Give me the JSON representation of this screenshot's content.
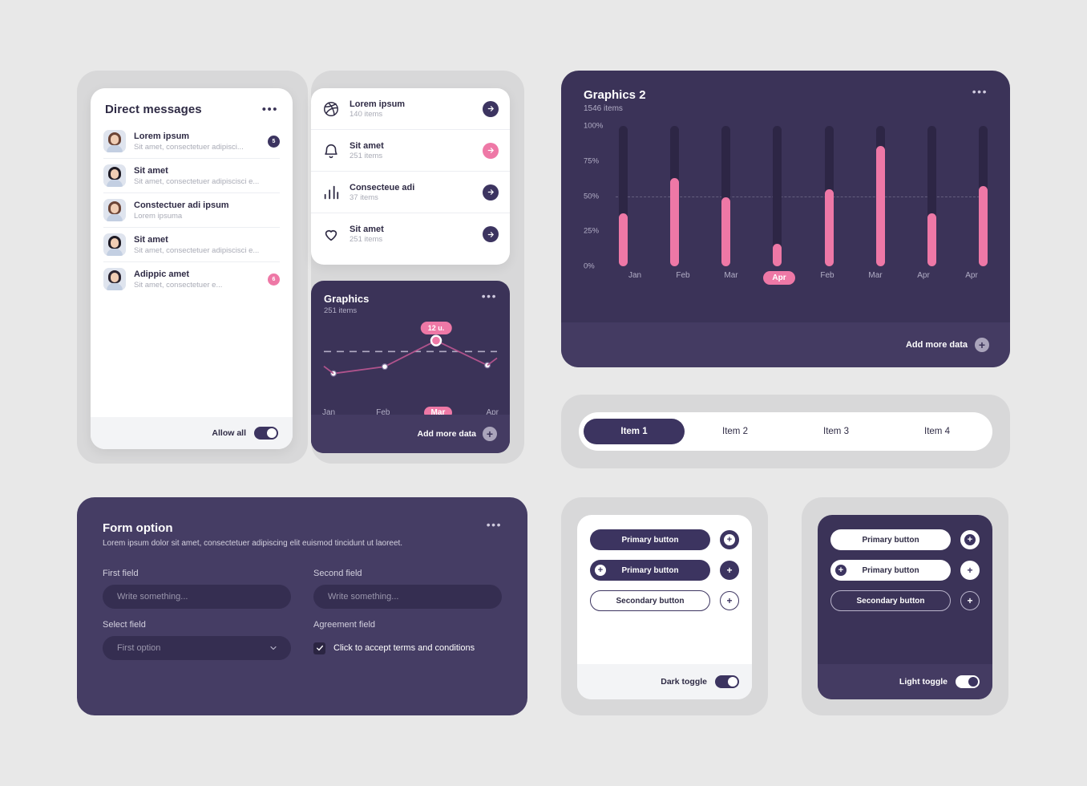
{
  "messages_card": {
    "title": "Direct messages",
    "menu_icon": "•••",
    "items": [
      {
        "name": "Lorem ipsum",
        "preview": "Sit amet, consectetuer adipisci...",
        "badge": "5",
        "badge_color": "#3c3460"
      },
      {
        "name": "Sit amet",
        "preview": "Sit amet, consectetuer adipiscisci e...",
        "badge": "",
        "badge_color": ""
      },
      {
        "name": "Constectuer adi ipsum",
        "preview": "Lorem ipsuma",
        "badge": "",
        "badge_color": ""
      },
      {
        "name": "Sit amet",
        "preview": "Sit amet, consectetuer adipiscisci e...",
        "badge": "",
        "badge_color": ""
      },
      {
        "name": "Adippic amet",
        "preview": "Sit amet, consectetuer e...",
        "badge": "6",
        "badge_color": "#ee78a6"
      }
    ],
    "footer": {
      "label": "Allow all",
      "toggle_state": "on"
    }
  },
  "icon_list_card": {
    "items": [
      {
        "icon": "dribbble-icon",
        "title": "Lorem ipsum",
        "subtitle": "140 items",
        "arrow_color": "#3c3460"
      },
      {
        "icon": "bell-icon",
        "title": "Sit amet",
        "subtitle": "251 items",
        "arrow_color": "#ee78a6"
      },
      {
        "icon": "bar-chart-icon",
        "title": "Consecteue adi",
        "subtitle": "37 items",
        "arrow_color": "#3c3460"
      },
      {
        "icon": "heart-icon",
        "title": "Sit amet",
        "subtitle": "251 items",
        "arrow_color": "#3c3460"
      }
    ]
  },
  "line_card": {
    "title": "Graphics",
    "subtitle": "251 items",
    "menu_icon": "•••",
    "footer_label": "Add more data",
    "plus_icon": "+"
  },
  "bar_card": {
    "title": "Graphics  2",
    "subtitle": "1546 items",
    "menu_icon": "•••",
    "footer_label": "Add more data",
    "plus_icon": "+"
  },
  "chart_data": [
    {
      "type": "line",
      "title": "Graphics",
      "subtitle": "251 items",
      "categories": [
        "Jan",
        "Feb",
        "Mar",
        "Apr"
      ],
      "values": [
        8,
        10.5,
        20,
        11
      ],
      "ylim": [
        0,
        24
      ],
      "active_category": "Mar",
      "tooltip": {
        "label": "12 u.",
        "category": "Mar"
      },
      "line_color": "#b0538c",
      "point_color": "#ffffff",
      "active_point_color": "#ee78a6",
      "reference_line": {
        "value": 16,
        "style": "dashed"
      },
      "grid": false,
      "legend": "none",
      "xlabel": "",
      "ylabel": ""
    },
    {
      "type": "bar",
      "title": "Graphics  2",
      "subtitle": "1546 items",
      "categories": [
        "Jan",
        "Feb",
        "Mar",
        "Apr",
        "Feb",
        "Mar",
        "Apr",
        "Apr"
      ],
      "values": [
        38,
        63,
        49,
        16,
        55,
        86,
        38,
        57
      ],
      "track_values": [
        100,
        100,
        100,
        100,
        100,
        100,
        100,
        100
      ],
      "ylim": [
        0,
        100
      ],
      "ytick_labels": [
        "100%",
        "75%",
        "50%",
        "25%",
        "0%"
      ],
      "yticks": [
        100,
        75,
        50,
        25,
        0
      ],
      "active_category_index": 3,
      "bar_color": "#ee78a6",
      "track_color": "#2d2645",
      "grid": true,
      "legend": "none",
      "xlabel": "",
      "ylabel": ""
    }
  ],
  "tabs": {
    "items": [
      {
        "label": "Item 1",
        "active": true
      },
      {
        "label": "Item 2",
        "active": false
      },
      {
        "label": "Item 3",
        "active": false
      },
      {
        "label": "Item 4",
        "active": false
      }
    ]
  },
  "form_card": {
    "title": "Form option",
    "description": "Lorem ipsum dolor sit amet, consectetuer adipiscing elit euismod tincidunt ut laoreet.",
    "menu_icon": "•••",
    "first_field": {
      "label": "First field",
      "value": "",
      "placeholder": "Write something..."
    },
    "second_field": {
      "label": "Second field",
      "value": "",
      "placeholder": "Write something..."
    },
    "select_field": {
      "label": "Select field",
      "selected": "First option",
      "chevron": "chevron-down-icon"
    },
    "agreement_field": {
      "label": "Agreement field",
      "checkbox_label": "Click to accept terms and conditions",
      "checked": true
    }
  },
  "buttons_light": {
    "primary_label": "Primary button",
    "primary_icon_label": "Primary button",
    "secondary_label": "Secondary button",
    "plus_icon": "+",
    "footer_label": "Dark toggle",
    "toggle_state": "on"
  },
  "buttons_dark": {
    "primary_label": "Primary button",
    "primary_icon_label": "Primary button",
    "secondary_label": "Secondary button",
    "plus_icon": "+",
    "footer_label": "Light toggle",
    "toggle_state": "on"
  },
  "theme": {
    "page_bg": "#e8e8e8",
    "wrapper_bg": "#d8d8d9",
    "dark_purple": "#3b3358",
    "deep_purple": "#3c3460",
    "accent_pink": "#ee78a6",
    "muted_text": "#b2aec6"
  }
}
